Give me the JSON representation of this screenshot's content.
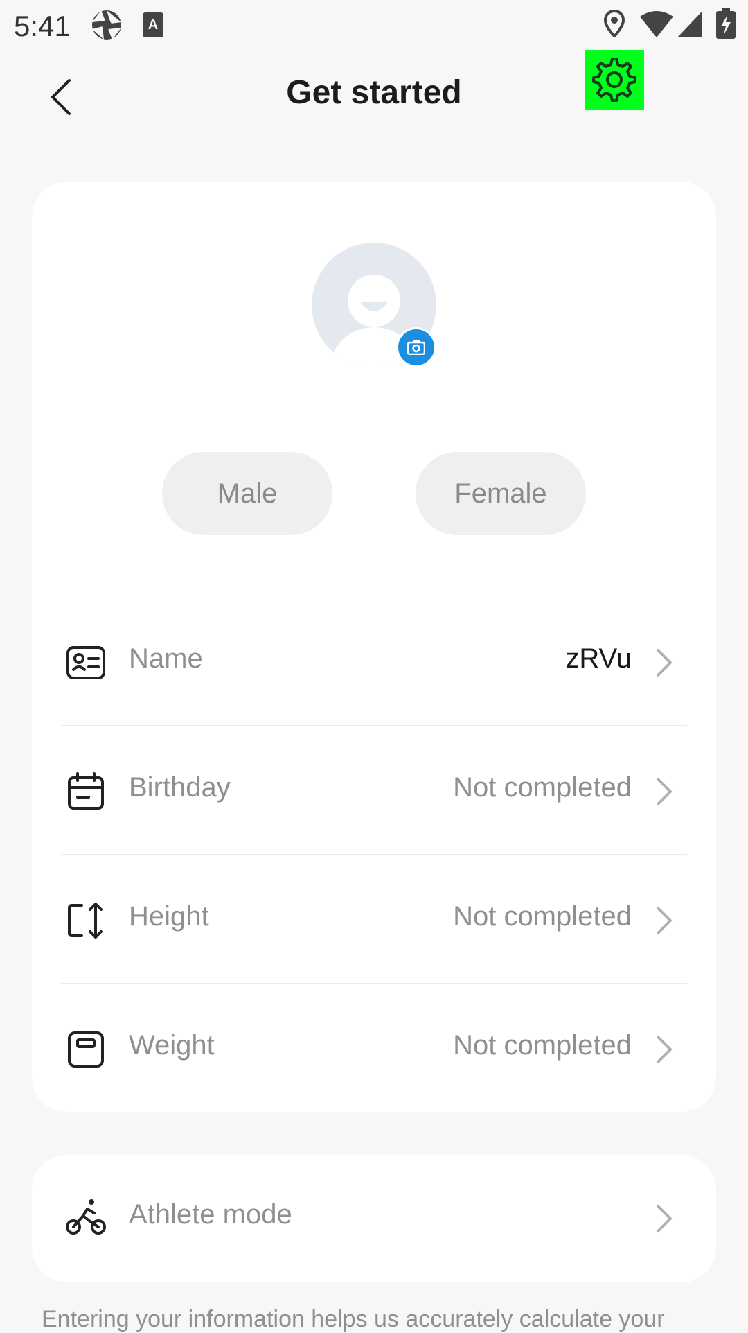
{
  "status_bar": {
    "time": "5:41"
  },
  "header": {
    "title": "Get started"
  },
  "gender": {
    "male_label": "Male",
    "female_label": "Female"
  },
  "profile_fields": [
    {
      "label": "Name",
      "value": "zRVu"
    },
    {
      "label": "Birthday",
      "value": "Not completed"
    },
    {
      "label": "Height",
      "value": "Not completed"
    },
    {
      "label": "Weight",
      "value": "Not completed"
    }
  ],
  "athlete": {
    "label": "Athlete mode"
  },
  "footer": {
    "text": "Entering your information helps us accurately calculate your"
  },
  "colors": {
    "accent": "#1a8fe0",
    "highlight": "#00ff1a",
    "muted_text": "#8f8f8f",
    "background": "#f7f7f7"
  }
}
